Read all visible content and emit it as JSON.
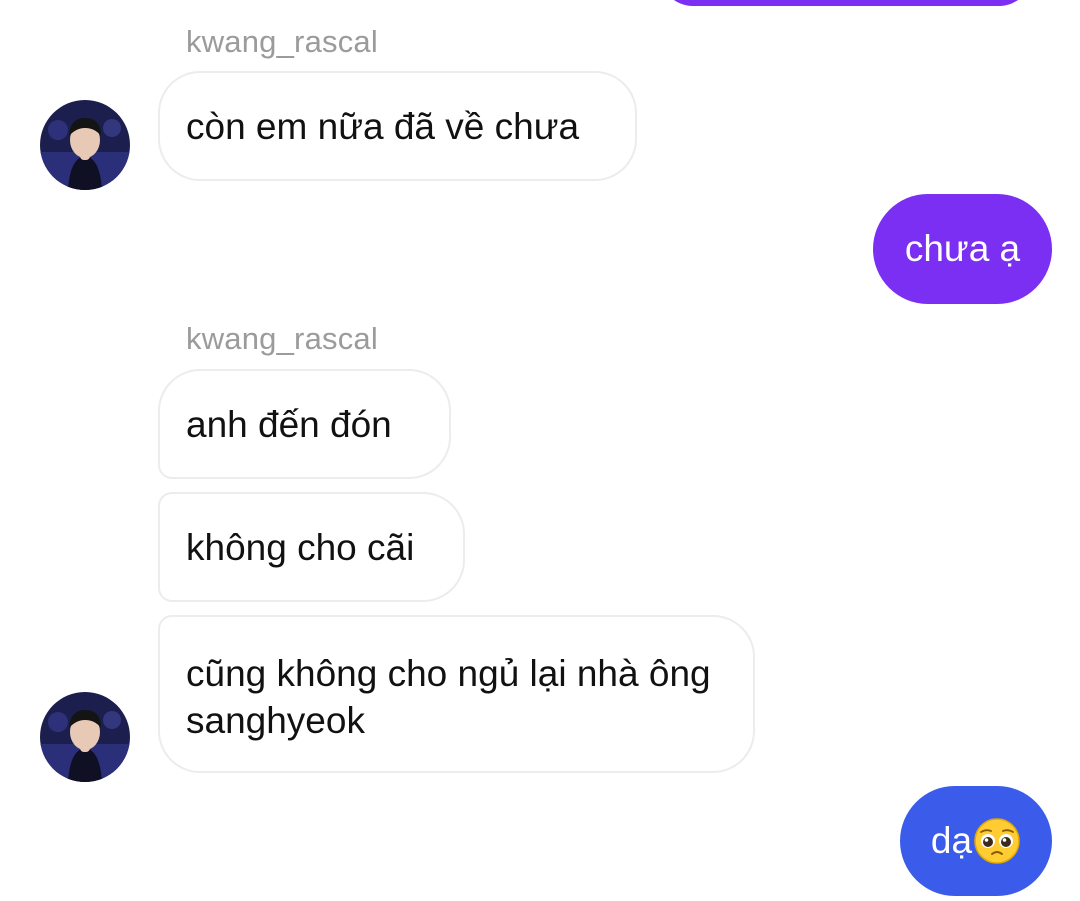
{
  "colors": {
    "outgoing_purple": "#7a2ff2",
    "outgoing_blue": "#3b5bea",
    "incoming_border": "#ececec",
    "sender_name": "#9b9b9b"
  },
  "messages": [
    {
      "type": "incoming",
      "sender": "kwang_rascal",
      "text": "còn em nữa đã về chưa"
    },
    {
      "type": "outgoing",
      "text": "chưa ạ"
    },
    {
      "type": "incoming",
      "sender": "kwang_rascal",
      "text": "anh đến đón"
    },
    {
      "type": "incoming",
      "text": "không cho cãi"
    },
    {
      "type": "incoming",
      "text": "cũng không cho ngủ lại nhà ông sanghyeok"
    },
    {
      "type": "outgoing",
      "text": "dạ",
      "emoji": "pleading-face-icon"
    }
  ]
}
